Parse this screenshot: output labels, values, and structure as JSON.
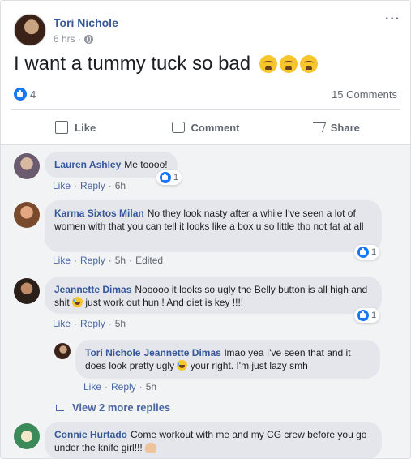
{
  "post": {
    "author": "Tori Nichole",
    "time": "6 hrs ·",
    "text": "I want a tummy tuck so bad",
    "reaction_count": "4",
    "comment_count": "15 Comments",
    "more": "···"
  },
  "actions": {
    "like": "Like",
    "comment": "Comment",
    "share": "Share"
  },
  "comments": [
    {
      "name": "Lauren Ashley",
      "text": "Me toooo!",
      "like": "Like",
      "reply": "Reply",
      "time": "6h",
      "reactions": "1"
    },
    {
      "name": "Karma Sixtos Milan",
      "text": "No they look nasty after a while I've seen a lot of women with that you can tell it looks like a box u so little tho not fat at all",
      "like": "Like",
      "reply": "Reply",
      "time": "5h",
      "edited": "Edited",
      "reactions": "1"
    },
    {
      "name": "Jeannette Dimas",
      "text_a": "Nooooo it looks so ugly the Belly button is all high and shit",
      "text_b": "just work out hun ! And diet is key !!!!",
      "like": "Like",
      "reply": "Reply",
      "time": "5h",
      "reactions": "1"
    },
    {
      "name": "Connie Hurtado",
      "text": "Come workout with me and my CG crew before you go under the knife girl!!!"
    }
  ],
  "reply": {
    "name": "Tori Nichole",
    "mention": "Jeannette Dimas",
    "text_a": "lmao yea I've seen that and it does look pretty ugly",
    "text_b": "your right. I'm just lazy smh",
    "like": "Like",
    "reply": "Reply",
    "time": "5h"
  },
  "view_more": "View 2 more replies",
  "colors": {
    "link": "#365899",
    "like_blue": "#1877f2",
    "bubble": "#e4e6eb",
    "meta": "#90949c"
  }
}
